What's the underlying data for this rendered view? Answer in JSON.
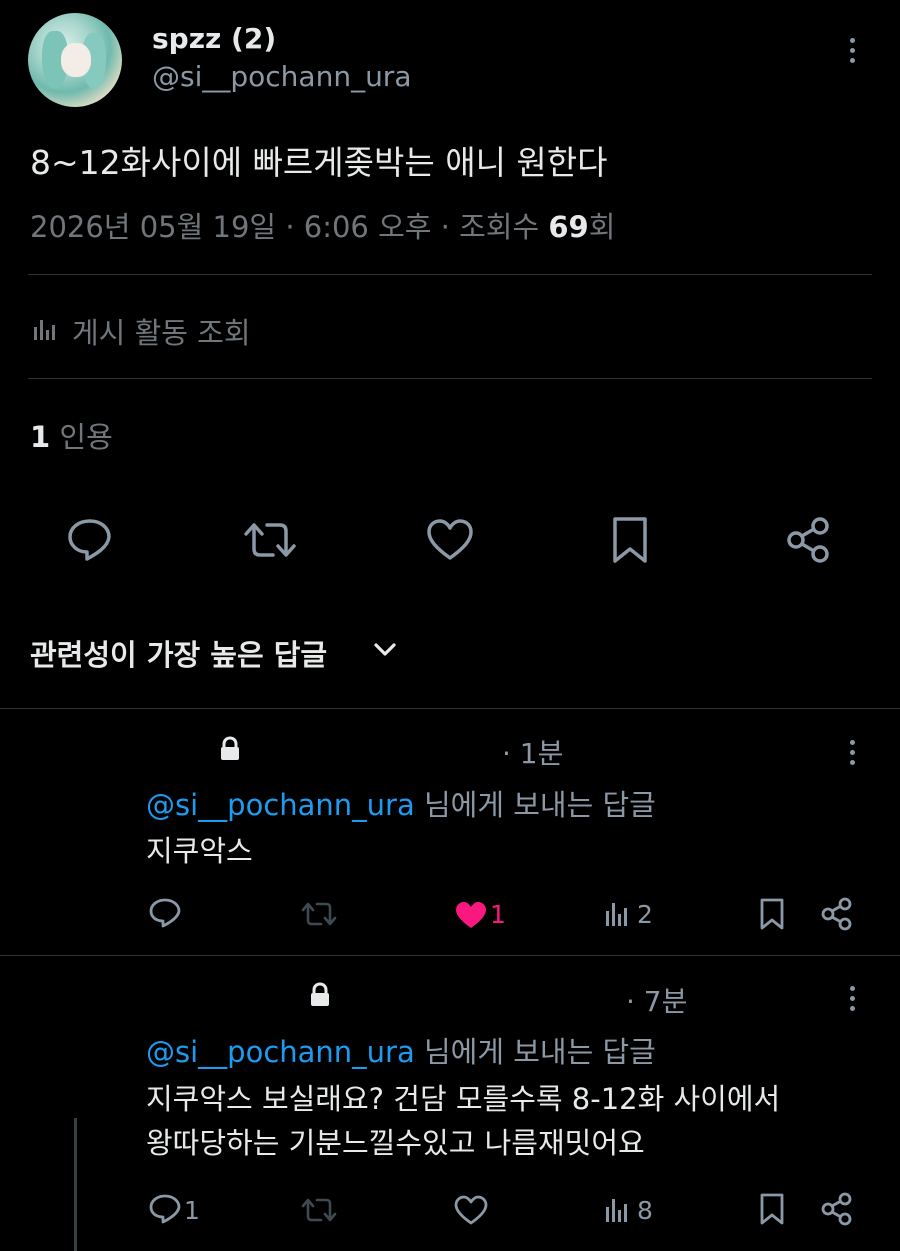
{
  "post": {
    "display_name": "spzz (2)",
    "handle": "@si__pochann_ura",
    "text": "8~12화사이에 빠르게좆박는 애니 원한다",
    "date": "2026년 05월 19일",
    "sep1": "·",
    "time": "6:06 오후",
    "sep2": "·",
    "views_label": "조회수",
    "views_count": "69",
    "views_suffix": "회",
    "activity_label": "게시 활동 조회",
    "quotes_count": "1",
    "quotes_label": "인용"
  },
  "sort": {
    "label": "관련성이 가장 높은 답글"
  },
  "replies": [
    {
      "time": "· 1분",
      "mention": "@si__pochann_ura",
      "reply_to_suffix": " 님에게 보내는 답글",
      "body": "지쿠악스",
      "like_count": "1",
      "view_count": "2",
      "reply_count": ""
    },
    {
      "time": "· 7분",
      "mention": "@si__pochann_ura",
      "reply_to_suffix": " 님에게 보내는 답글",
      "body_line1": "지쿠악스 보실래요? 건담 모를수록 8-12화 사이에서",
      "body_line2": "왕따당하는 기분느낄수있고 나름재밋어요",
      "reply_count": "1",
      "view_count": "8"
    }
  ],
  "colors": {
    "background": "#000000",
    "text": "#e7e9ea",
    "muted": "#71767b",
    "link": "#1d9bf0",
    "like": "#f91880"
  }
}
